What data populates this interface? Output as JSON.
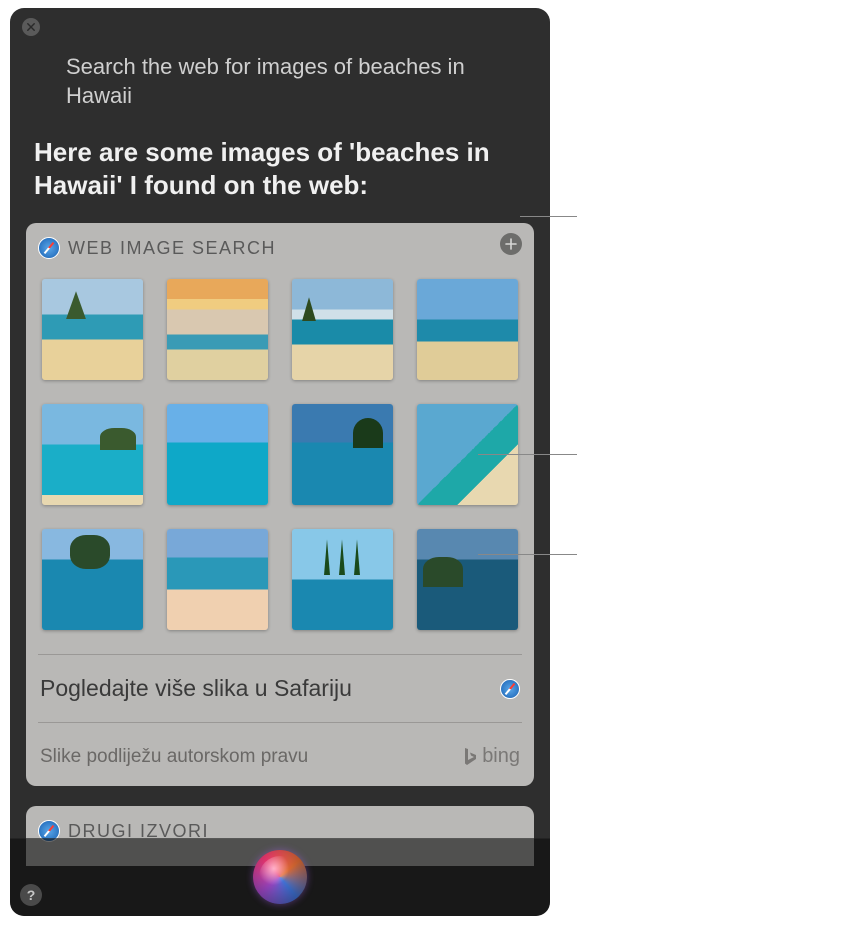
{
  "query": "Search the web for images of beaches in Hawaii",
  "response": "Here are some images of 'beaches in Hawaii' I found on the web:",
  "card": {
    "title": "WEB IMAGE SEARCH",
    "more_label": "Pogledajte više slika u Safariju",
    "copyright": "Slike podliježu autorskom pravu",
    "provider": "bing"
  },
  "card2": {
    "title": "DRUGI IZVORI"
  },
  "help_glyph": "?",
  "icons": {
    "close": "close-icon",
    "add": "plus-icon",
    "safari": "safari-icon",
    "siri": "siri-orb-icon",
    "help": "help-icon",
    "bing": "bing-icon"
  }
}
